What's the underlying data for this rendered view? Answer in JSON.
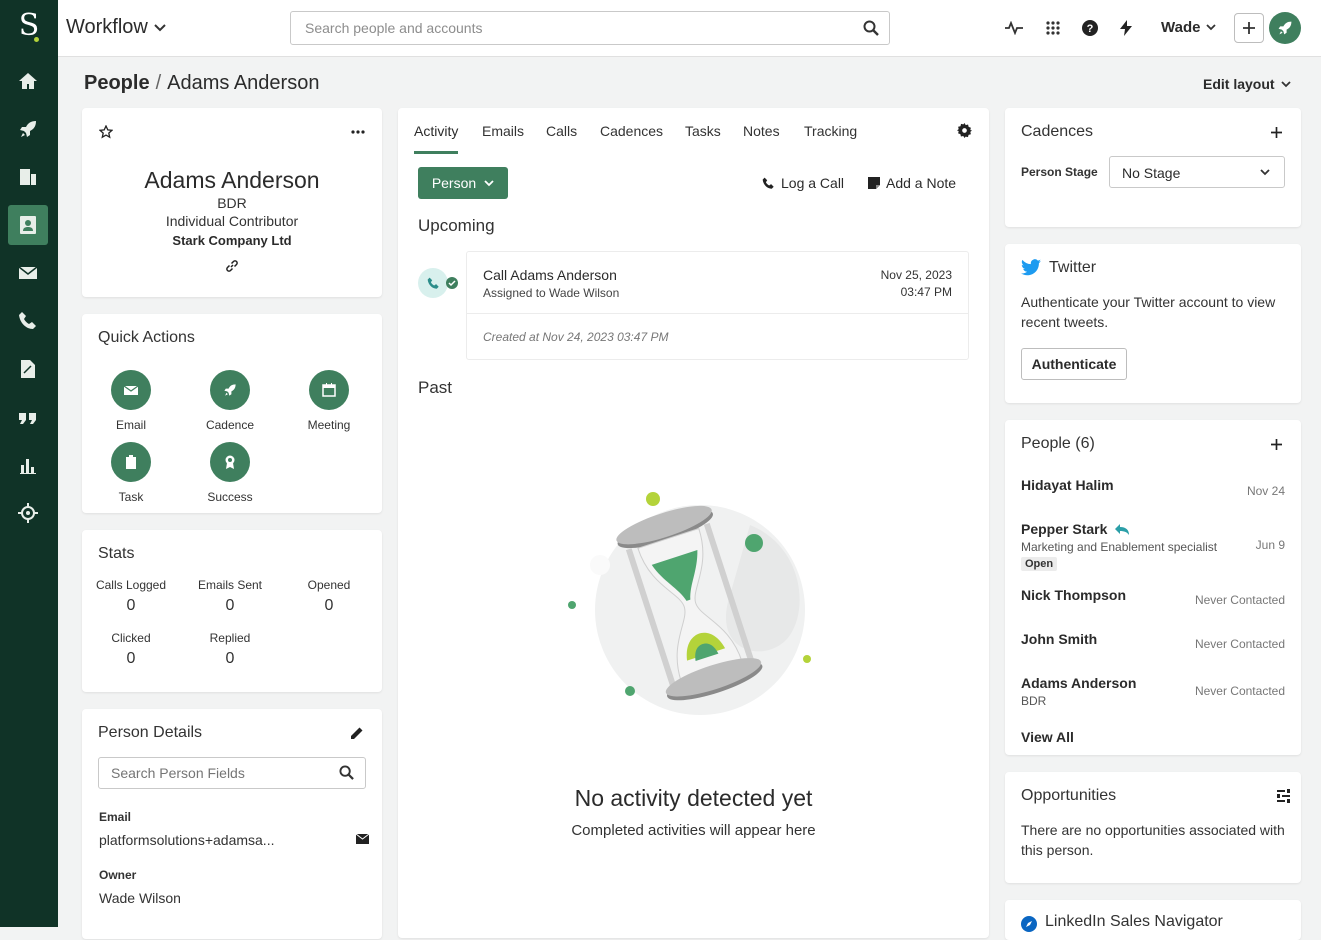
{
  "app": {
    "logo": "S",
    "workflow": "Workflow",
    "search_placeholder": "Search people and accounts",
    "user": "Wade"
  },
  "breadcrumb": {
    "root": "People",
    "current": "Adams Anderson"
  },
  "edit_layout": "Edit layout",
  "profile": {
    "name": "Adams Anderson",
    "title": "BDR",
    "role": "Individual Contributor",
    "company": "Stark Company Ltd"
  },
  "quick_actions": {
    "title": "Quick Actions",
    "items": [
      "Email",
      "Cadence",
      "Meeting",
      "Task",
      "Success"
    ]
  },
  "stats": {
    "title": "Stats",
    "items": [
      {
        "label": "Calls Logged",
        "value": "0"
      },
      {
        "label": "Emails Sent",
        "value": "0"
      },
      {
        "label": "Opened",
        "value": "0"
      },
      {
        "label": "Clicked",
        "value": "0"
      },
      {
        "label": "Replied",
        "value": "0"
      }
    ]
  },
  "person_details": {
    "title": "Person Details",
    "search_placeholder": "Search Person Fields",
    "email_label": "Email",
    "email_value": "platformsolutions+adamsa...",
    "owner_label": "Owner",
    "owner_value": "Wade Wilson"
  },
  "tabs": [
    "Activity",
    "Emails",
    "Calls",
    "Cadences",
    "Tasks",
    "Notes",
    "Tracking"
  ],
  "activity": {
    "person_button": "Person",
    "log_call": "Log a Call",
    "add_note": "Add a Note",
    "upcoming": "Upcoming",
    "past": "Past",
    "task": {
      "title": "Call Adams Anderson",
      "assigned": "Assigned to Wade Wilson",
      "date": "Nov 25, 2023",
      "time": "03:47 PM",
      "created": "Created at Nov 24, 2023 03:47 PM"
    },
    "empty_title": "No activity detected yet",
    "empty_sub": "Completed activities will appear here"
  },
  "cadences": {
    "title": "Cadences",
    "stage_label": "Person Stage",
    "stage_value": "No Stage"
  },
  "twitter": {
    "title": "Twitter",
    "text": "Authenticate your Twitter account to view recent tweets.",
    "button": "Authenticate"
  },
  "people": {
    "title": "People (6)",
    "view_all": "View All",
    "rows": [
      {
        "name": "Hidayat Halim",
        "date": "Nov 24"
      },
      {
        "name": "Pepper Stark",
        "sub": "Marketing and Enablement specialist",
        "badge": "Open",
        "date": "Jun 9"
      },
      {
        "name": "Nick Thompson",
        "date": "Never Contacted"
      },
      {
        "name": "John Smith",
        "date": "Never Contacted"
      },
      {
        "name": "Adams Anderson",
        "sub": "BDR",
        "date": "Never Contacted"
      }
    ]
  },
  "opportunities": {
    "title": "Opportunities",
    "text": "There are no opportunities associated with this person."
  },
  "linkedin": {
    "title": "LinkedIn Sales Navigator"
  },
  "colors": {
    "sidebar": "#103327",
    "accent": "#3f7f5e",
    "lime": "#b4d33a"
  }
}
